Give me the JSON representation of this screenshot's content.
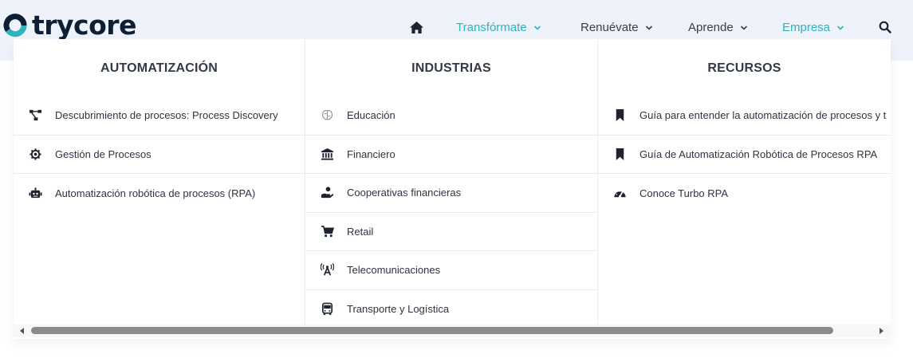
{
  "brand": {
    "name": "trycore",
    "colors": {
      "accent": "#2fb3bd",
      "dark": "#0f1f33"
    }
  },
  "nav": {
    "home_icon": "home-icon",
    "search_icon": "search-icon",
    "items": [
      {
        "label": "Transfórmate",
        "active": true
      },
      {
        "label": "Renuévate",
        "active": false
      },
      {
        "label": "Aprende",
        "active": false
      },
      {
        "label": "Empresa",
        "active": true
      }
    ]
  },
  "menu": {
    "columns": [
      {
        "title": "AUTOMATIZACIÓN",
        "items": [
          {
            "label": "Descubrimiento de procesos: Process Discovery",
            "icon": "process-flow-icon"
          },
          {
            "label": "Gestión de Procesos",
            "icon": "gear-icon"
          },
          {
            "label": "Automatización robótica de procesos (RPA)",
            "icon": "robot-icon"
          }
        ]
      },
      {
        "title": "INDUSTRIAS",
        "items": [
          {
            "label": "Educación",
            "icon": "brain-icon"
          },
          {
            "label": "Financiero",
            "icon": "bank-icon"
          },
          {
            "label": "Cooperativas financieras",
            "icon": "hand-coin-icon"
          },
          {
            "label": "Retail",
            "icon": "cart-icon"
          },
          {
            "label": "Telecomunicaciones",
            "icon": "broadcast-tower-icon"
          },
          {
            "label": "Transporte y Logística",
            "icon": "bus-icon"
          }
        ]
      },
      {
        "title": "RECURSOS",
        "items": [
          {
            "label": "Guía para entender la automatización de procesos y t",
            "icon": "bookmark-icon"
          },
          {
            "label": "Guía de Automatización Robótica de Procesos RPA",
            "icon": "bookmark-icon"
          },
          {
            "label": "Conoce Turbo RPA",
            "icon": "gauge-icon"
          }
        ]
      }
    ]
  }
}
